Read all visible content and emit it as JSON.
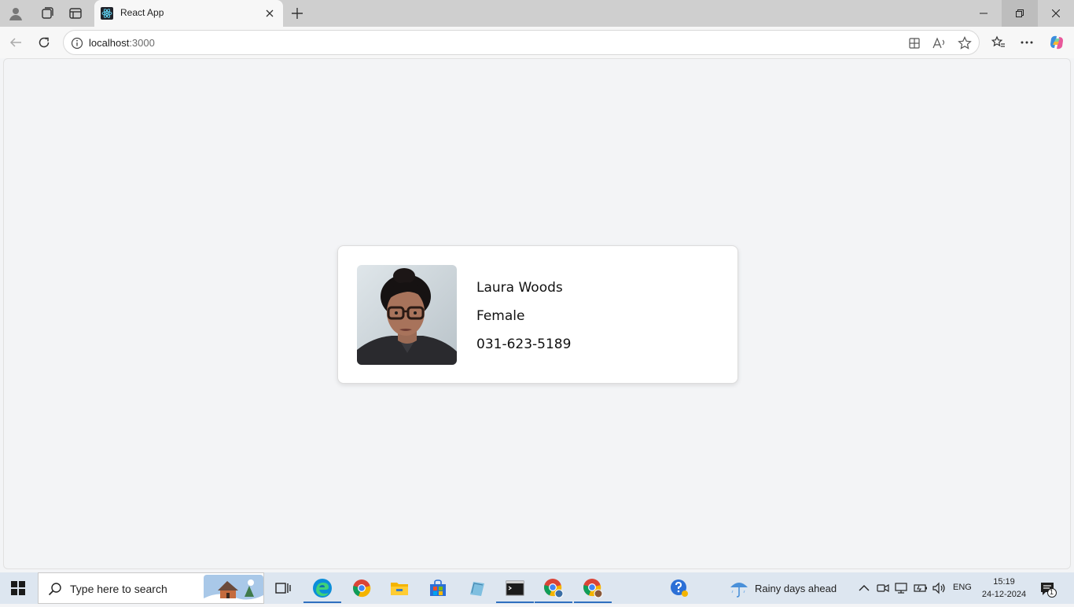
{
  "browser": {
    "tab_title": "React App",
    "url_host": "localhost",
    "url_port": ":3000"
  },
  "profile_card": {
    "name": "Laura Woods",
    "gender": "Female",
    "phone": "031-623-5189"
  },
  "taskbar": {
    "search_placeholder": "Type here to search",
    "weather": "Rainy days ahead",
    "language": "ENG",
    "time": "15:19",
    "date": "24-12-2024",
    "notification_count": "1"
  },
  "colors": {
    "page_bg": "#f3f4f6",
    "card_bg": "#ffffff",
    "taskbar_bg": "#dde6f0",
    "titlebar_bg": "#cfcfcf"
  }
}
